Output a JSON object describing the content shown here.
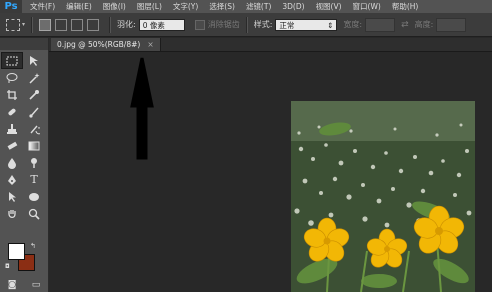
{
  "app": {
    "logo": "Ps"
  },
  "menu": [
    "文件(F)",
    "编辑(E)",
    "图像(I)",
    "图层(L)",
    "文字(Y)",
    "选择(S)",
    "滤镜(T)",
    "3D(D)",
    "视图(V)",
    "窗口(W)",
    "帮助(H)"
  ],
  "options": {
    "feather_label": "羽化:",
    "feather_value": "0 像素",
    "antialias_label": "消除锯齿",
    "style_label": "样式:",
    "style_value": "正常",
    "width_label": "宽度:",
    "height_label": "高度:"
  },
  "document": {
    "tab_title": "0.jpg @ 50%(RGB/8#)",
    "tab_close": "×"
  },
  "colors": {
    "foreground": "#ffffff",
    "background": "#8b2e14",
    "logo_accent": "#31a8ff"
  }
}
